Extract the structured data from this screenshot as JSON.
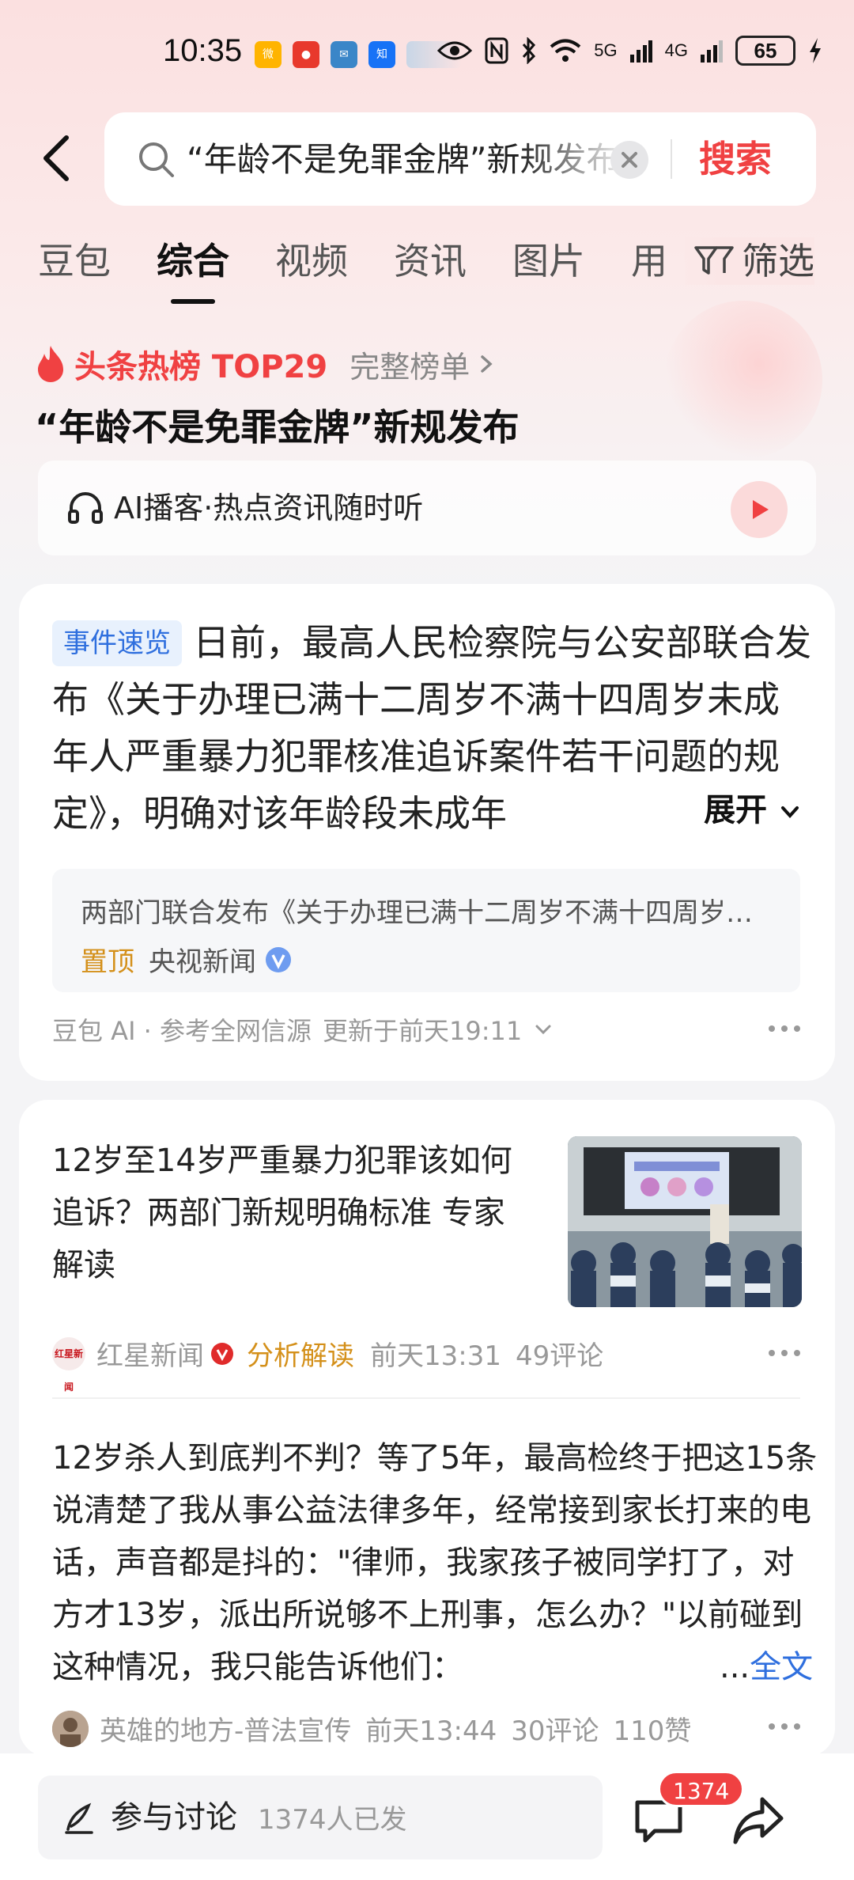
{
  "status_bar": {
    "time": "10:35",
    "signal1": "5G",
    "signal2": "4G",
    "battery": "65"
  },
  "search": {
    "query": "“年龄不是免罪金牌”新规发布",
    "button": "搜索"
  },
  "tabs": [
    "豆包",
    "综合",
    "视频",
    "资讯",
    "图片",
    "用"
  ],
  "filter": "筛选",
  "hot": {
    "label": "头条热榜 TOP29",
    "full_list": "完整榜单",
    "title": "“年龄不是免罪金牌”新规发布"
  },
  "podcast": {
    "text": "AI播客·热点资讯随时听"
  },
  "summary_card": {
    "badge": "事件速览",
    "text": "日前，最高人民检察院与公安部联合发布《关于办理已满十二周岁不满十四周岁未成年人严重暴力犯罪核准追诉案件若干问题的规定》，明确对该年龄段未成年",
    "expand": "展开",
    "source_title": "两部门联合发布《关于办理已满十二周岁不满十四周岁未成年人严重暴力犯罪核准追诉案件若干问题的规定》",
    "pin": "置顶",
    "source_name": "央视新闻",
    "ai_source": "豆包 AI · 参考全网信源",
    "updated": "更新于前天19:11"
  },
  "news1": {
    "title": "12岁至14岁严重暴力犯罪该如何追诉？两部门新规明确标准 专家解读",
    "source": "红星新闻",
    "logo_text": "红星新闻",
    "tag": "分析解读",
    "time": "前天13:31",
    "comments": "49评论"
  },
  "post": {
    "text": "12岁杀人到底判不判？等了5年，最高检终于把这15条说清楚了我从事公益法律多年，经常接到家长打来的电话，声音都是抖的：\"律师，我家孩子被同学打了，对方才13岁，派出所说够不上刑事，怎么办？\"以前碰到这种情况，我只能告诉他们：",
    "ellipsis": "...",
    "full_text": "全文",
    "author": "英雄的地方-普法宣传",
    "time": "前天13:44",
    "comments": "30评论",
    "likes": "110赞"
  },
  "bottom": {
    "discuss": "参与讨论",
    "discuss_count": "1374人已发",
    "comment_badge": "1374"
  },
  "colors": {
    "accent": "#f04142",
    "link": "#2f6fde",
    "tag": "#d4901a"
  }
}
